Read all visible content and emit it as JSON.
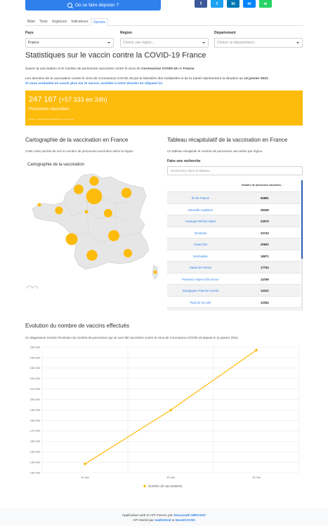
{
  "header": {
    "cta_label": "Où se faire dépister ?",
    "share": [
      {
        "icon": "facebook-icon",
        "glyph": "f",
        "color": "#3b5998"
      },
      {
        "icon": "twitter-icon",
        "glyph": "t",
        "color": "#1da1f2"
      },
      {
        "icon": "linkedin-icon",
        "glyph": "in",
        "color": "#0077b5"
      },
      {
        "icon": "messenger-icon",
        "glyph": "m",
        "color": "#0084ff"
      },
      {
        "icon": "whatsapp-icon",
        "glyph": "w",
        "color": "#25d366"
      }
    ]
  },
  "tabs": [
    "Bilan",
    "Tests",
    "Urgences",
    "Indicateurs",
    "Vaccins"
  ],
  "active_tab": "Vaccins",
  "filters": {
    "pays_label": "Pays",
    "pays_value": "France",
    "region_label": "Région",
    "region_placeholder": "Choisir une région...",
    "dept_label": "Département",
    "dept_placeholder": "Choisir un département..."
  },
  "page": {
    "title": "Statistiques sur le vaccin contre la COVID-19 France",
    "intro_prefix": "Suivez la vaccination et le nombre de personnes vaccinées contre le virus de ",
    "intro_strong1": "Coronavirus COVID-19",
    "intro_mid": " en ",
    "intro_strong2": "France",
    "data_prefix": "Les données de la vaccination contre le virus de Coronavirus COVID-19 par le Ministère des Solidarités et de la Santé représentent la situation au ",
    "data_date": "13 janvier 2021",
    "data_link": "Si vous souhaitez en savoir plus sur le vaccin, accédez à notre dossier en cliquant ici."
  },
  "stat": {
    "value": "247 167",
    "delta": "(+57 333 en 24h)",
    "label": "Personnes Vaccinées",
    "source": "Source : Ministère des Solidarités et de la Santé",
    "color": "#fdbb0c"
  },
  "map_section": {
    "title": "Cartographie de la vaccination en France",
    "desc": "Cette carte permet de voir le nombre de personnes vaccinées selon la région",
    "map_title": "Cartographie de la vaccination"
  },
  "table_section": {
    "title": "Tableau récapitulatif de la vaccination en France",
    "desc": "Ce tableau récapitule le nombre de personnes vaccinées par région.",
    "search_label": "Faire une recherche",
    "search_placeholder": "Rechercher dans le tableau...",
    "column_header": "Nombre de personnes vaccinées ↓",
    "rows": [
      {
        "region": "Île-de-France",
        "value": "50881"
      },
      {
        "region": "Nouvelle-Aquitaine",
        "value": "28428"
      },
      {
        "region": "Auvergne-Rhône-Alpes",
        "value": "24979"
      },
      {
        "region": "Occitanie",
        "value": "23743"
      },
      {
        "region": "Grand Est",
        "value": "20692"
      },
      {
        "region": "Normandie",
        "value": "18971"
      },
      {
        "region": "Hauts-de-France",
        "value": "17763"
      },
      {
        "region": "Provence-Alpes-Côte d'Azur",
        "value": "14769"
      },
      {
        "region": "Bourgogne-Franche-Comté",
        "value": "14102"
      },
      {
        "region": "Pays de la Loire",
        "value": "12354"
      },
      {
        "region": "",
        "value": ""
      }
    ]
  },
  "chart_section": {
    "title": "Evolution du nombre de vaccins effectués",
    "desc": "Ce diagramme montre l'évolution du nombre de personnes qui se sont fait vaccinées contre le virus de Coronavirus COVID-19 depuis le 11 janvier 2021."
  },
  "chart_data": {
    "type": "line",
    "categories": [
      "11 Jan",
      "12 Jan",
      "13 Jan"
    ],
    "series": [
      {
        "name": "Nombre de vaccinations",
        "values": [
          138351,
          189834,
          247167
        ],
        "color": "#fdbb0c"
      }
    ],
    "ylim": [
      130000,
      250000
    ],
    "yticks": [
      130000,
      140000,
      150000,
      160000,
      170000,
      180000,
      190000,
      200000,
      210000,
      220000,
      230000,
      240000,
      250000
    ],
    "legend": "bottom",
    "grid": true
  },
  "footer": {
    "line1_prefix": "Application web et API France par ",
    "line1_author": "Souryvath NIRASAY",
    "line2_prefix": "API World par ",
    "line2_a": "mathdroid",
    "line2_mid": " & ",
    "line2_b": "NovelCOVID"
  }
}
